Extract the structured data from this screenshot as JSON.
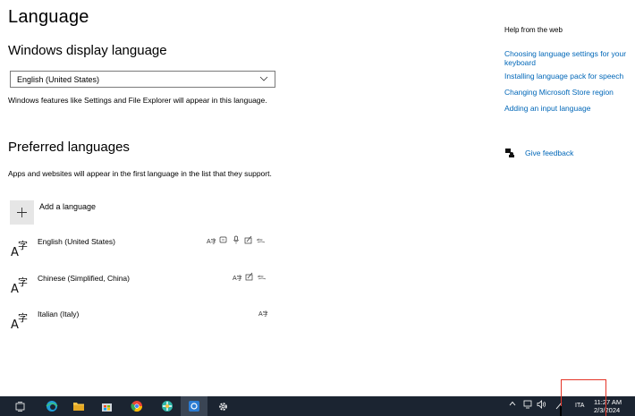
{
  "page": {
    "title": "Language",
    "display_language": {
      "heading": "Windows display language",
      "selected": "English (United States)",
      "description": "Windows features like Settings and File Explorer will appear in this language."
    },
    "preferred": {
      "heading": "Preferred languages",
      "description": "Apps and websites will appear in the first language in the list that they support.",
      "add_label": "Add a language",
      "languages": [
        {
          "name": "English (United States)",
          "features": [
            "display-language-icon",
            "text-to-speech-icon",
            "speech-recognition-icon",
            "handwriting-icon",
            "basic-typing-icon"
          ]
        },
        {
          "name": "Chinese (Simplified, China)",
          "features": [
            "display-language-icon",
            "handwriting-icon",
            "basic-typing-icon"
          ]
        },
        {
          "name": "Italian (Italy)",
          "features": [
            "display-language-icon"
          ]
        }
      ]
    }
  },
  "help": {
    "heading": "Help from the web",
    "links": [
      "Choosing language settings for your",
      "keyboard",
      "Installing language pack for speech",
      "Changing Microsoft Store region",
      "Adding an input language"
    ],
    "feedback": "Give feedback"
  },
  "taskbar": {
    "apps": [
      "task-view-icon",
      "edge-icon",
      "file-explorer-icon",
      "store-icon",
      "chrome-icon",
      "app-icon",
      "mail-app-icon",
      "settings-icon"
    ],
    "input_indicator": "ITA",
    "time": "11:27 AM",
    "date": "2/3/2024"
  },
  "colors": {
    "accent_link": "#0067b8",
    "taskbar_bg": "#1b2431",
    "highlight_box": "#e53528"
  }
}
